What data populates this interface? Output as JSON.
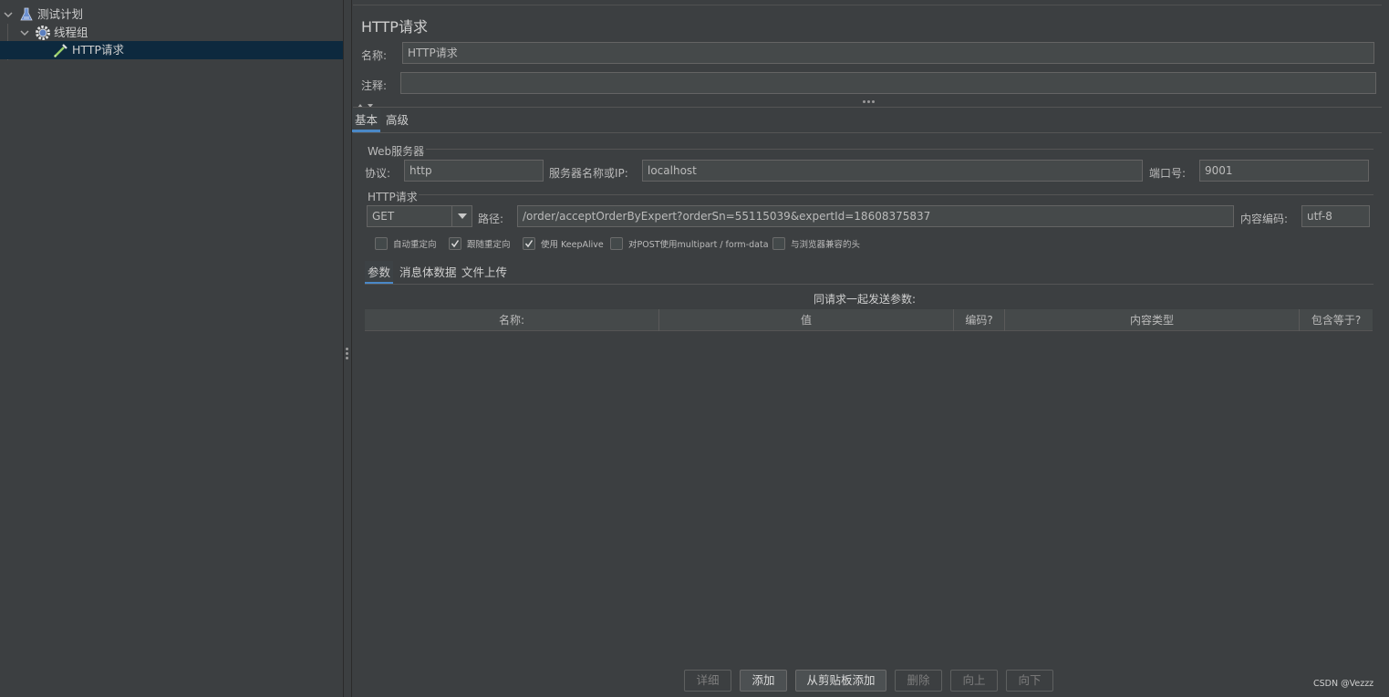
{
  "tree": {
    "items": [
      {
        "label": "测试计划",
        "icon": "flask-icon"
      },
      {
        "label": "线程组",
        "icon": "gear-icon"
      },
      {
        "label": "HTTP请求",
        "icon": "pipette-icon"
      }
    ]
  },
  "panel": {
    "title": "HTTP请求",
    "name_label": "名称:",
    "name_value": "HTTP请求",
    "comment_label": "注释:",
    "comment_value": ""
  },
  "tabs": [
    "基本",
    "高级"
  ],
  "web_server": {
    "group_title": "Web服务器",
    "protocol_label": "协议:",
    "protocol_value": "http",
    "server_label": "服务器名称或IP:",
    "server_value": "localhost",
    "port_label": "端口号:",
    "port_value": "9001"
  },
  "http_request": {
    "group_title": "HTTP请求",
    "method": "GET",
    "path_label": "路径:",
    "path_value": "/order/acceptOrderByExpert?orderSn=55115039&expertId=18608375837",
    "encoding_label": "内容编码:",
    "encoding_value": "utf-8"
  },
  "options": [
    {
      "label": "自动重定向",
      "checked": false
    },
    {
      "label": "跟随重定向",
      "checked": true
    },
    {
      "label": "使用 KeepAlive",
      "checked": true
    },
    {
      "label": "对POST使用multipart / form-data",
      "checked": false
    },
    {
      "label": "与浏览器兼容的头",
      "checked": false
    }
  ],
  "sub_tabs": [
    "参数",
    "消息体数据",
    "文件上传"
  ],
  "params": {
    "caption": "同请求一起发送参数:",
    "columns": [
      "名称:",
      "值",
      "编码?",
      "内容类型",
      "包含等于?"
    ]
  },
  "buttons": [
    {
      "label": "详细",
      "enabled": false
    },
    {
      "label": "添加",
      "enabled": true
    },
    {
      "label": "从剪贴板添加",
      "enabled": true
    },
    {
      "label": "删除",
      "enabled": false
    },
    {
      "label": "向上",
      "enabled": false
    },
    {
      "label": "向下",
      "enabled": false
    }
  ],
  "watermark": "CSDN @Vezzz",
  "colors": {
    "background": "#3c3f41",
    "selection": "#0d293e",
    "accent": "#4a88c7"
  }
}
